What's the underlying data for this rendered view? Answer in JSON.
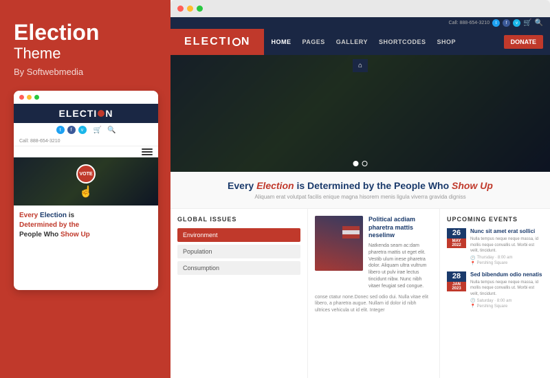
{
  "left": {
    "title": "Election",
    "subtitle": "Theme",
    "author": "By Softwebmedia",
    "dots": [
      "red",
      "yellow",
      "green"
    ],
    "mobile_logo": "ELECTI",
    "mobile_logo_o": "O",
    "mobile_logo_n": "N",
    "phone": "Call: 888-654-3210",
    "vote_label": "VOTE",
    "headline_line1": "Every",
    "headline_red": "Election",
    "headline_line2": "is",
    "headline_blue": "Determined by the",
    "headline_line3": "People Who",
    "headline_highlight": "Show Up"
  },
  "right": {
    "window_dots": [
      "red",
      "yellow",
      "green"
    ],
    "header": {
      "phone": "Call: 888-654-3210",
      "logo": "ELECTI",
      "logo_o": "O",
      "logo_n": "N",
      "nav_items": [
        "HOME",
        "PAGES",
        "GALLERY",
        "SHORTCODES",
        "SHOP"
      ],
      "donate_btn": "DONATE"
    },
    "hero": {
      "home_icon": "⌂",
      "dots": [
        true,
        false
      ]
    },
    "tagline": {
      "every": "Every",
      "election": "Election",
      "middle": "is Determined by the People Who",
      "show_up": "Show Up",
      "sub": "Aliquam erat volutpat facilis enique magna hisorem menis ligula viverra gravida digniss"
    },
    "global_issues": {
      "title": "GLOBAL ISSUES",
      "items": [
        {
          "label": "Environment",
          "active": true
        },
        {
          "label": "Population",
          "active": false
        },
        {
          "label": "Consumption",
          "active": false
        }
      ]
    },
    "article": {
      "title": "Political acdiam pharetra mattis neselinw",
      "body": "Natkenda seam ac:dam pharetra mattis ut eget elit. Vestib ulum inese pharetra dolor. Aliquam ultra vultrum libero ut pulv irae lectus tincidunt nibw. Nunc nibh vitaer feugiat sed congue.",
      "footer": "conse ctatur none.Donec sed odio dui. Nulla vitae elit libero, a pharetra augue. Nullam id dolor id nibh ultrices vehicula ut id elit. Integer"
    },
    "upcoming_events": {
      "title": "UPCOMING EVENTS",
      "events": [
        {
          "day": "26",
          "month": "MAY",
          "year": "2022",
          "title": "Nunc sit amet erat sollici",
          "desc": "Nulla tempus neque neque massa, id mollis neque convallis ut. Morbi est velit, tincidunt.",
          "day_of_week": "Thursday",
          "time": "8:00 am",
          "location": "Pershing Square"
        },
        {
          "day": "28",
          "month": "JAN",
          "year": "2023",
          "title": "Sed bibendum odio nenatis",
          "desc": "Nulla tempus neque neque massa, id mollis neque convallis ut. Morbi est velit, tincidunt.",
          "day_of_week": "Saturday",
          "time": "8:00 am",
          "location": "Pershing Square"
        }
      ]
    }
  }
}
